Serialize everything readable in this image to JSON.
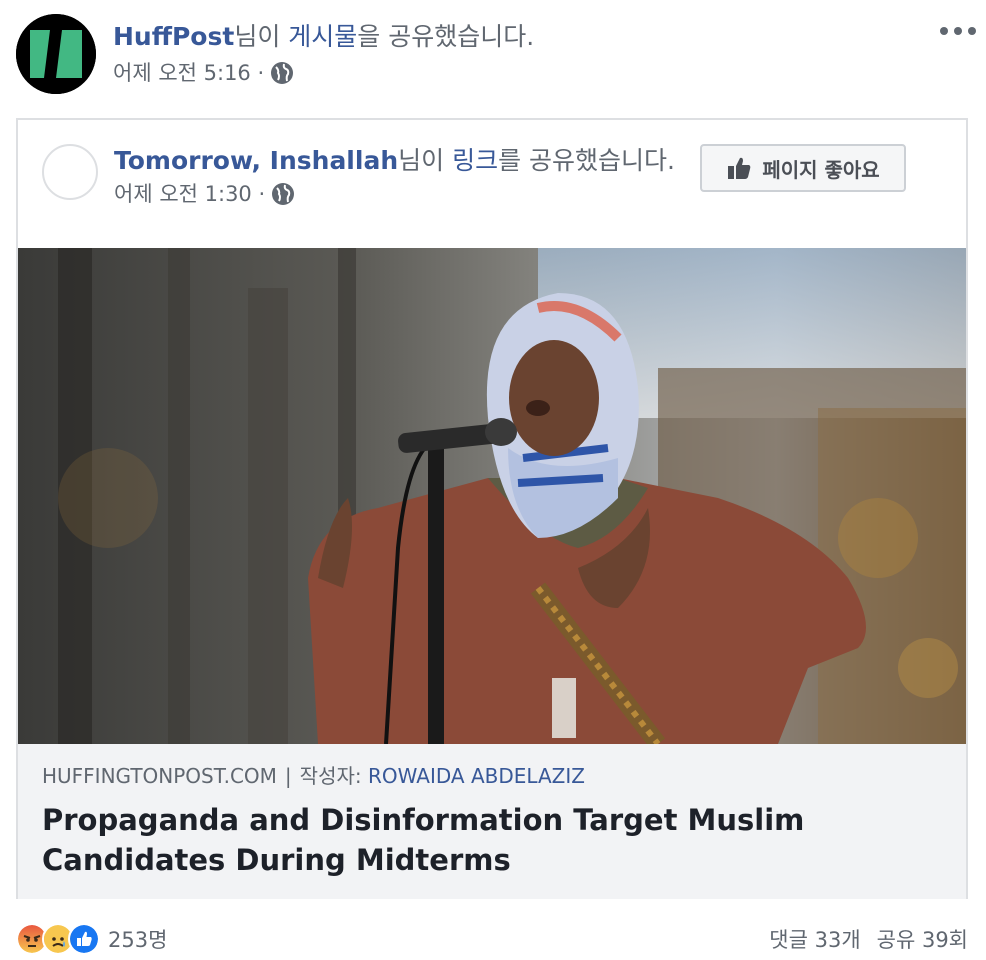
{
  "post": {
    "author": "HuffPost",
    "action_suffix_1": "님이 ",
    "action_link": "게시물",
    "action_suffix_2": "을 공유했습니다.",
    "time": "어제 오전 5:16 ·",
    "menu_icon": "more-dots-icon"
  },
  "shared": {
    "author": "Tomorrow, Inshallah",
    "action_suffix_1": "님이 ",
    "action_link": "링크",
    "action_suffix_2": "를 공유했습니다.",
    "time": "어제 오전 1:30 ·",
    "like_page_label": "페이지 좋아요",
    "like_icon": "thumbs-up-icon"
  },
  "link": {
    "domain": "HUFFINGTONPOST.COM",
    "separator": "|",
    "author_prefix": "작성자: ",
    "author": "ROWAIDA ABDELAZIZ",
    "title": "Propaganda and Disinformation Target Muslim Candidates During Midterms"
  },
  "footer": {
    "reaction_icons": [
      "angry-icon",
      "sad-icon",
      "like-icon"
    ],
    "reaction_count": "253명",
    "comments": "댓글 33개",
    "shares": "공유 39회"
  },
  "colors": {
    "link_blue": "#385898",
    "meta_gray": "#606770",
    "huffpost_green": "#2bb673",
    "like_blue": "#1877f2"
  }
}
